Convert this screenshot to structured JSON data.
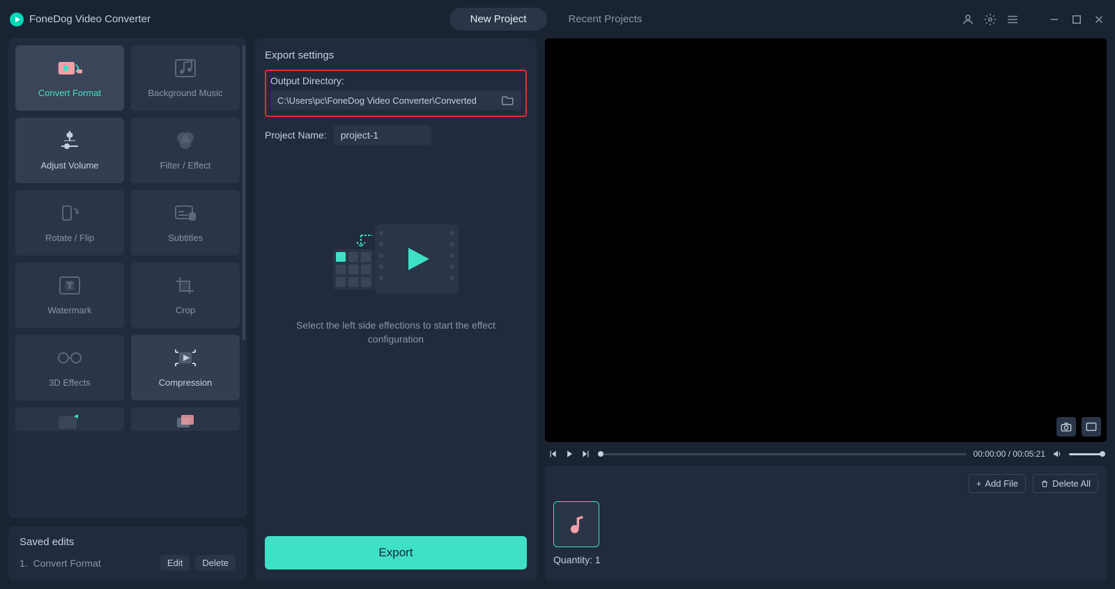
{
  "app": {
    "title": "FoneDog Video Converter"
  },
  "tabs": {
    "new_project": "New Project",
    "recent_projects": "Recent Projects"
  },
  "tools": [
    {
      "label": "Convert Format",
      "selected": true,
      "icon": "convert"
    },
    {
      "label": "Background Music",
      "selected": false,
      "icon": "music"
    },
    {
      "label": "Adjust Volume",
      "selected": false,
      "icon": "volume",
      "highlight": true
    },
    {
      "label": "Filter / Effect",
      "selected": false,
      "icon": "filter"
    },
    {
      "label": "Rotate / Flip",
      "selected": false,
      "icon": "rotate"
    },
    {
      "label": "Subtitles",
      "selected": false,
      "icon": "subtitles"
    },
    {
      "label": "Watermark",
      "selected": false,
      "icon": "watermark"
    },
    {
      "label": "Crop",
      "selected": false,
      "icon": "crop"
    },
    {
      "label": "3D Effects",
      "selected": false,
      "icon": "3d"
    },
    {
      "label": "Compression",
      "selected": false,
      "icon": "compress",
      "highlight": true
    }
  ],
  "saved": {
    "title": "Saved edits",
    "items": [
      {
        "num": "1.",
        "name": "Convert Format"
      }
    ],
    "edit_btn": "Edit",
    "delete_btn": "Delete"
  },
  "export": {
    "section_title": "Export settings",
    "outdir_label": "Output Directory:",
    "outdir_value": "C:\\Users\\pc\\FoneDog Video Converter\\Converted",
    "projname_label": "Project Name:",
    "projname_value": "project-1",
    "placeholder_text": "Select the left side effections to start the effect configuration",
    "export_btn": "Export"
  },
  "player": {
    "time_current": "00:00:00",
    "time_total": "00:05:21"
  },
  "filebar": {
    "add_btn": "Add File",
    "delete_btn": "Delete All",
    "quantity_label": "Quantity:",
    "quantity_value": "1"
  }
}
